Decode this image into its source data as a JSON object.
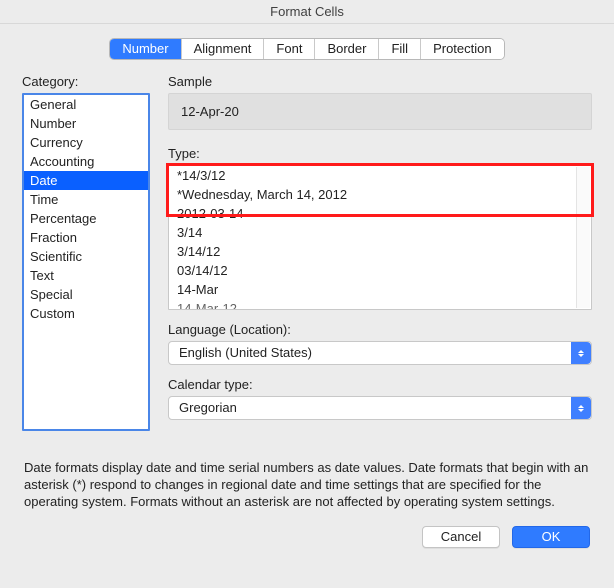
{
  "window": {
    "title": "Format Cells"
  },
  "tabs": {
    "items": [
      {
        "label": "Number",
        "active": true
      },
      {
        "label": "Alignment",
        "active": false
      },
      {
        "label": "Font",
        "active": false
      },
      {
        "label": "Border",
        "active": false
      },
      {
        "label": "Fill",
        "active": false
      },
      {
        "label": "Protection",
        "active": false
      }
    ]
  },
  "labels": {
    "category": "Category:",
    "sample": "Sample",
    "type": "Type:",
    "language": "Language (Location):",
    "calendar": "Calendar type:"
  },
  "category": {
    "items": [
      {
        "label": "General",
        "selected": false
      },
      {
        "label": "Number",
        "selected": false
      },
      {
        "label": "Currency",
        "selected": false
      },
      {
        "label": "Accounting",
        "selected": false
      },
      {
        "label": "Date",
        "selected": true
      },
      {
        "label": "Time",
        "selected": false
      },
      {
        "label": "Percentage",
        "selected": false
      },
      {
        "label": "Fraction",
        "selected": false
      },
      {
        "label": "Scientific",
        "selected": false
      },
      {
        "label": "Text",
        "selected": false
      },
      {
        "label": "Special",
        "selected": false
      },
      {
        "label": "Custom",
        "selected": false
      }
    ]
  },
  "sample": {
    "value": "12-Apr-20"
  },
  "type": {
    "items": [
      "*14/3/12",
      "*Wednesday, March 14, 2012",
      "2012-03-14",
      "3/14",
      "3/14/12",
      "03/14/12",
      "14-Mar",
      "14-Mar-12"
    ]
  },
  "language": {
    "value": "English (United States)"
  },
  "calendar": {
    "value": "Gregorian"
  },
  "info": {
    "text": "Date formats display date and time serial numbers as date values.  Date formats that begin with an asterisk (*) respond to changes in regional date and time settings that are specified for the operating system. Formats without an asterisk are not affected by operating system settings."
  },
  "buttons": {
    "cancel": "Cancel",
    "ok": "OK"
  }
}
